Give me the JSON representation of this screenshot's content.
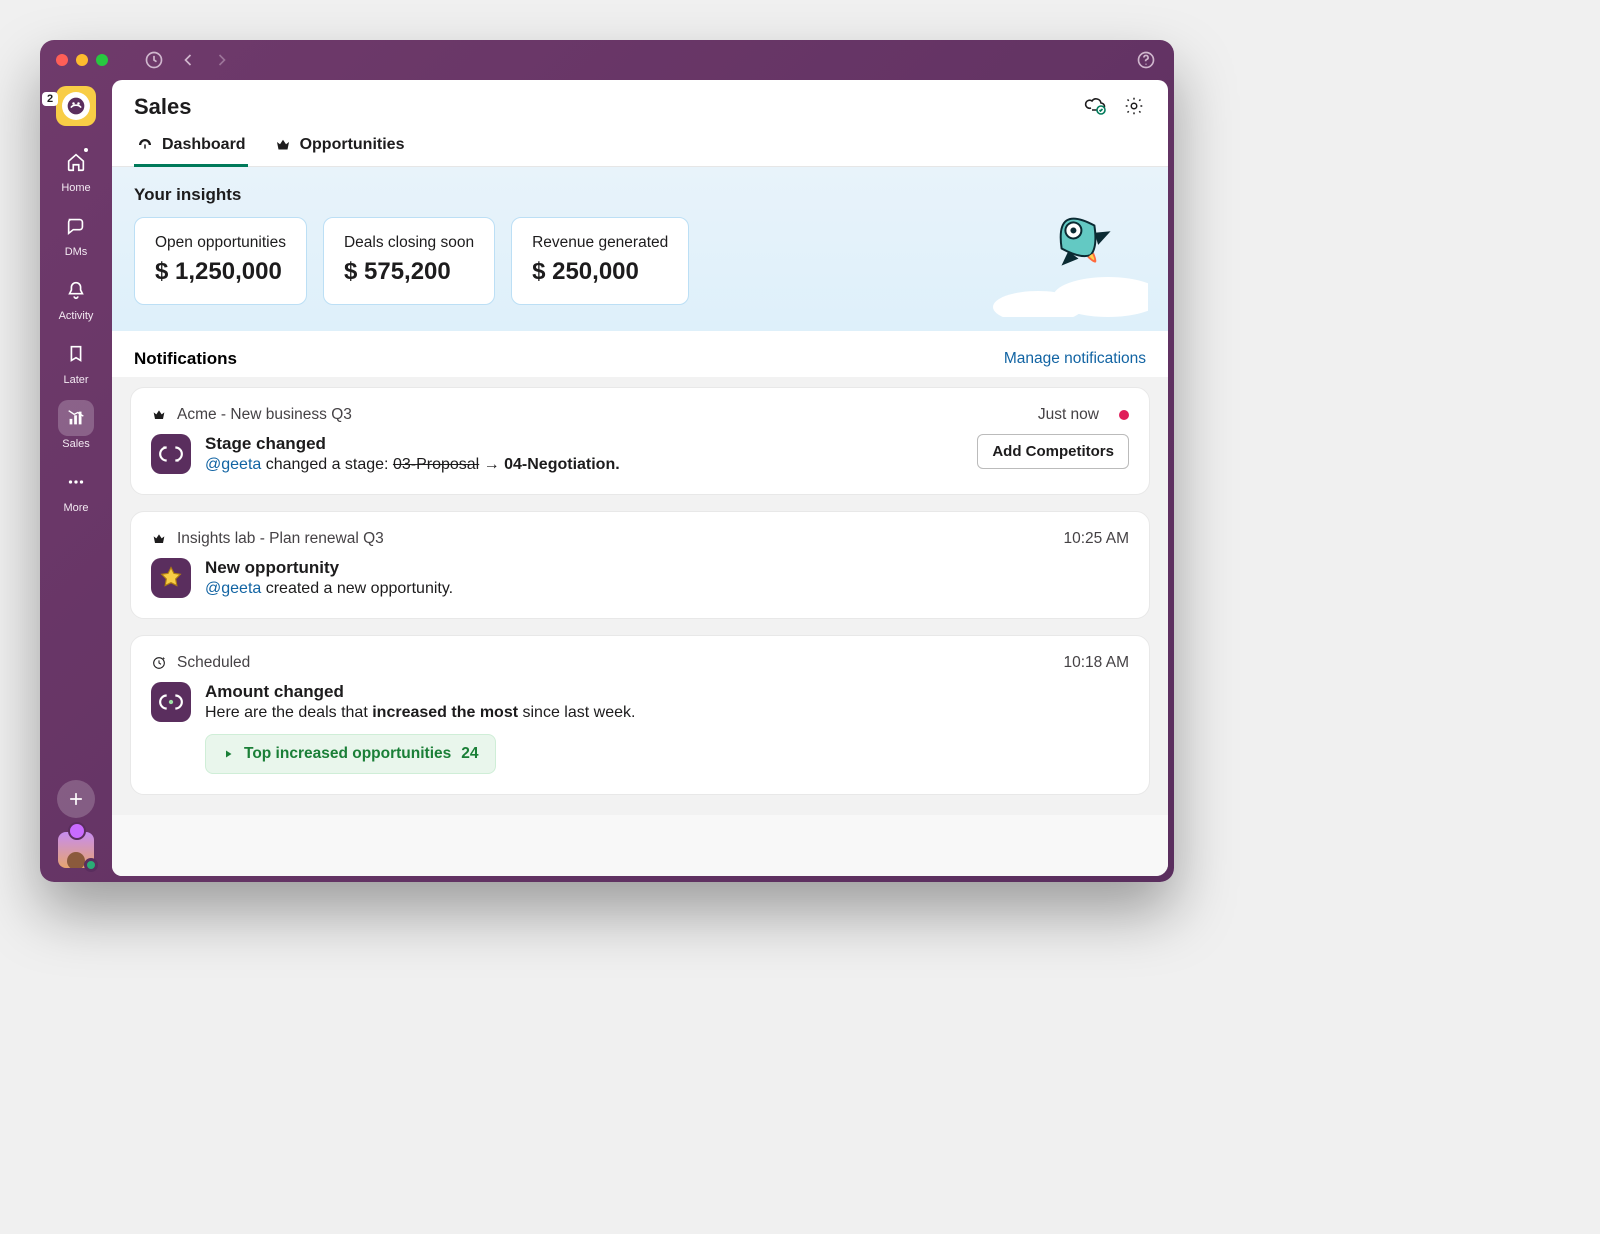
{
  "workspace": {
    "badge_count": "2"
  },
  "sidebar": {
    "items": [
      {
        "label": "Home"
      },
      {
        "label": "DMs"
      },
      {
        "label": "Activity"
      },
      {
        "label": "Later"
      },
      {
        "label": "Sales"
      },
      {
        "label": "More"
      }
    ]
  },
  "header": {
    "title": "Sales"
  },
  "tabs": [
    {
      "label": "Dashboard"
    },
    {
      "label": "Opportunities"
    }
  ],
  "insights": {
    "heading": "Your insights",
    "cards": [
      {
        "label": "Open opportunities",
        "value": "$ 1,250,000"
      },
      {
        "label": "Deals closing soon",
        "value": "$ 575,200"
      },
      {
        "label": "Revenue generated",
        "value": "$ 250,000"
      }
    ]
  },
  "notifications": {
    "heading": "Notifications",
    "manage_label": "Manage notifications",
    "items": [
      {
        "header": "Acme - New business Q3",
        "timestamp": "Just now",
        "live_dot": true,
        "title": "Stage changed",
        "mention": "@geeta",
        "text_before": " changed a stage: ",
        "struck": "03-Proposal",
        "arrow": " → ",
        "after_strong": "04-Negotiation.",
        "action": "Add Competitors"
      },
      {
        "header": "Insights lab - Plan renewal Q3",
        "timestamp": "10:25 AM",
        "title": "New opportunity",
        "mention": "@geeta",
        "text_after_mention": " created a new opportunity."
      },
      {
        "header": "Scheduled",
        "timestamp": "10:18 AM",
        "title": "Amount changed",
        "plain_before": "Here are the deals that ",
        "bold_mid": "increased the most",
        "plain_after": " since last week.",
        "pill_label": "Top increased opportunities",
        "pill_count": "24"
      }
    ]
  }
}
